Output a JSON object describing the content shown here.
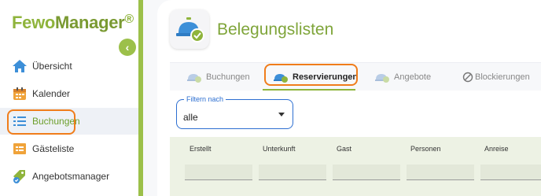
{
  "brand": {
    "name_part1": "Fewo",
    "name_part2": "Manager",
    "registered": "®"
  },
  "sidebar": {
    "collapse_glyph": "‹",
    "items": [
      {
        "label": "Übersicht",
        "icon": "home-icon"
      },
      {
        "label": "Kalender",
        "icon": "calendar-icon"
      },
      {
        "label": "Buchungen",
        "icon": "list-icon",
        "active": true
      },
      {
        "label": "Gästeliste",
        "icon": "guest-list-icon"
      },
      {
        "label": "Angebotsmanager",
        "icon": "offer-tag-icon"
      }
    ]
  },
  "page": {
    "title": "Belegungslisten",
    "icon": "reception-bell-check-icon"
  },
  "tabs": [
    {
      "label": "Buchungen"
    },
    {
      "label": "Reservierungen",
      "active": true
    },
    {
      "label": "Angebote"
    },
    {
      "label": "Blockierungen"
    }
  ],
  "filter": {
    "label": "Filtern nach",
    "value": "alle"
  },
  "table": {
    "columns": [
      "Erstellt",
      "Unterkunft",
      "Gast",
      "Personen",
      "Anreise"
    ]
  },
  "colors": {
    "brand_green": "#8fb43c",
    "annotation_orange": "#f07d1b",
    "focus_blue": "#2d6fd1"
  }
}
